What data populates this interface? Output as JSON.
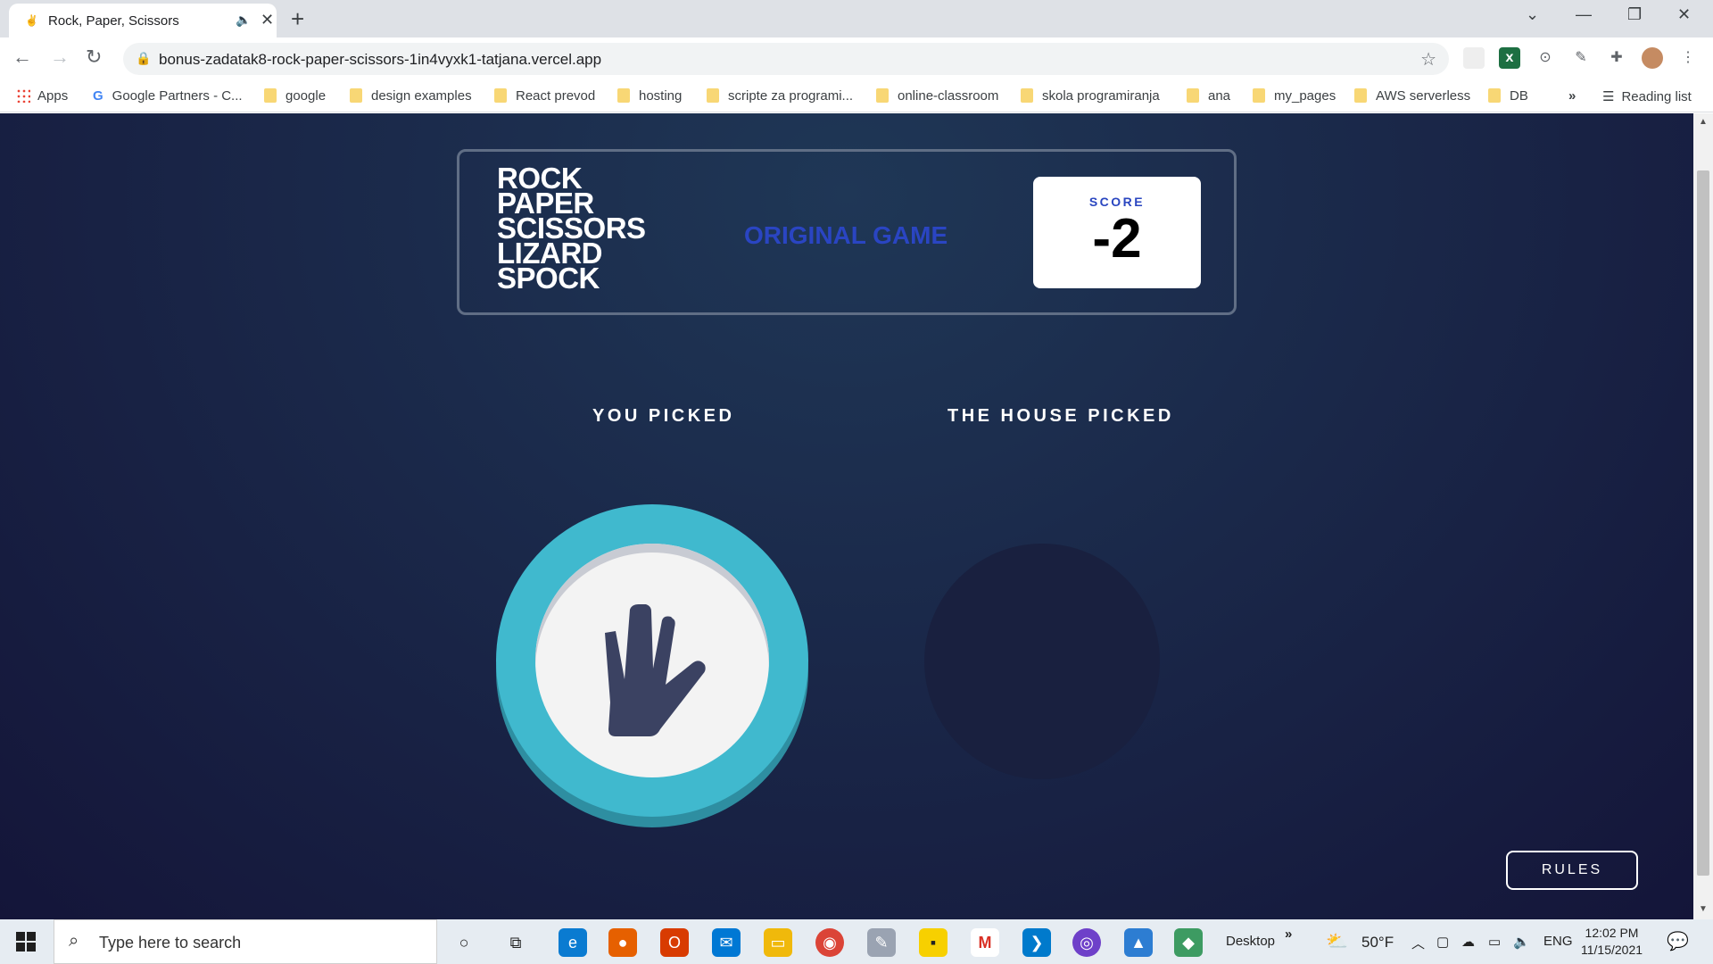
{
  "browser": {
    "tab_title": "Rock, Paper, Scissors",
    "url": "bonus-zadatak8-rock-paper-scissors-1in4vyxk1-tatjana.vercel.app",
    "bookmarks": [
      "Apps",
      "Google Partners - C...",
      "google",
      "design examples",
      "React prevod",
      "hosting",
      "scripte za programi...",
      "online-classroom",
      "skola programiranja",
      "ana",
      "my_pages",
      "AWS serverless",
      "DB"
    ],
    "reading_list": "Reading list",
    "more_bookmarks": "»"
  },
  "game": {
    "logo_lines": [
      "ROCK",
      "PAPER",
      "SCISSORS",
      "LIZARD",
      "SPOCK"
    ],
    "mode_label": "ORIGINAL GAME",
    "score_label": "SCORE",
    "score_value": "-2",
    "you_picked": "YOU PICKED",
    "house_picked": "THE HOUSE PICKED",
    "player_choice": "spock",
    "chip_color": "#40b9ce",
    "rules_button": "RULES"
  },
  "taskbar": {
    "search_placeholder": "Type here to search",
    "desktop_label": "Desktop",
    "chevron": "»",
    "weather": "50°F",
    "language": "ENG",
    "time": "12:02 PM",
    "date": "11/15/2021"
  }
}
